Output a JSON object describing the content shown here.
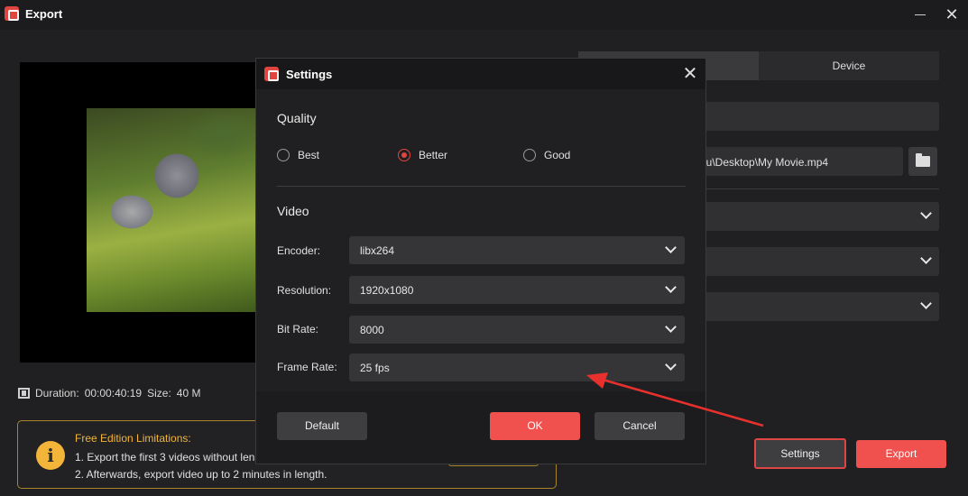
{
  "window": {
    "title": "Export"
  },
  "preview": {
    "duration_label": "Duration:",
    "duration_value": "00:00:40:19",
    "size_label": "Size:",
    "size_value": "40 M"
  },
  "right_panel": {
    "tab_device": "Device",
    "save_path": "zlu\\Desktop\\My Movie.mp4"
  },
  "limitations": {
    "title": "Free Edition Limitations:",
    "line1": "1. Export the first 3 videos without len",
    "line2": "2. Afterwards, export video up to 2 minutes in length."
  },
  "actions": {
    "settings": "Settings",
    "export": "Export"
  },
  "dialog": {
    "title": "Settings",
    "quality": {
      "title": "Quality",
      "options": [
        "Best",
        "Better",
        "Good"
      ],
      "selected": "Better"
    },
    "video": {
      "title": "Video",
      "encoder_label": "Encoder:",
      "encoder_value": "libx264",
      "resolution_label": "Resolution:",
      "resolution_value": "1920x1080",
      "bitrate_label": "Bit Rate:",
      "bitrate_value": "8000",
      "framerate_label": "Frame Rate:",
      "framerate_value": "25 fps"
    },
    "buttons": {
      "default": "Default",
      "ok": "OK",
      "cancel": "Cancel"
    }
  },
  "colors": {
    "accent": "#f0514f",
    "warning": "#f2b53a",
    "annotation": "#e8302c"
  }
}
